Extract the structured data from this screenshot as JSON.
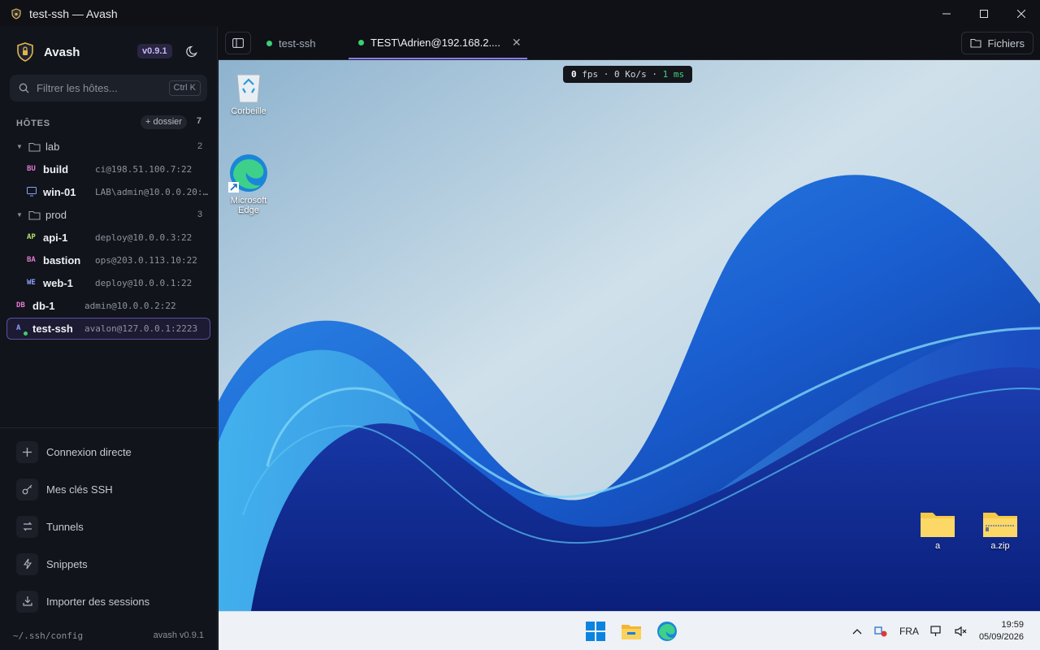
{
  "window": {
    "title": "test-ssh — Avash",
    "controls": [
      "minimize-icon",
      "maximize-icon",
      "close-icon"
    ]
  },
  "sidebar": {
    "app_name": "Avash",
    "version_badge": "v0.9.1",
    "search": {
      "placeholder": "Filtrer les hôtes...",
      "shortcut": "Ctrl K"
    },
    "hosts_title": "HÔTES",
    "add_folder_label": "+ dossier",
    "hosts_count": "7",
    "folders": [
      {
        "name": "lab",
        "count": "2",
        "hosts": [
          {
            "abbr": "BU",
            "name": "build",
            "address": "ci@198.51.100.7:22",
            "abbr_color": "#e07ad0"
          },
          {
            "abbr": "",
            "icon": "monitor-icon",
            "name": "win-01",
            "address": "LAB\\admin@10.0.0.20:…"
          }
        ]
      },
      {
        "name": "prod",
        "count": "3",
        "hosts": [
          {
            "abbr": "AP",
            "name": "api-1",
            "address": "deploy@10.0.0.3:22",
            "abbr_color": "#b8e06a"
          },
          {
            "abbr": "BA",
            "name": "bastion",
            "address": "ops@203.0.113.10:22",
            "abbr_color": "#e07ad0"
          },
          {
            "abbr": "WE",
            "name": "web-1",
            "address": "deploy@10.0.0.1:22",
            "abbr_color": "#8ea0ff"
          }
        ]
      }
    ],
    "root_hosts": [
      {
        "abbr": "DB",
        "name": "db-1",
        "address": "admin@10.0.0.2:22",
        "abbr_color": "#e07ad0"
      },
      {
        "abbr": "A",
        "name": "test-ssh",
        "address": "avalon@127.0.0.1:2223",
        "abbr_color": "#8ea0ff",
        "active": true,
        "online": true
      }
    ],
    "actions": [
      {
        "label": "Connexion directe",
        "icon": "plus-icon"
      },
      {
        "label": "Mes clés SSH",
        "icon": "key-icon"
      },
      {
        "label": "Tunnels",
        "icon": "tunnel-icon"
      },
      {
        "label": "Snippets",
        "icon": "lightning-icon"
      },
      {
        "label": "Importer des sessions",
        "icon": "import-icon"
      }
    ],
    "footer_left": "~/.ssh/config",
    "footer_right": "avash v0.9.1"
  },
  "tabs": [
    {
      "label": "test-ssh",
      "status": "connected",
      "active": false
    },
    {
      "label": "TEST\\Adrien@192.168.2....",
      "status": "connected",
      "active": true
    }
  ],
  "files_button": "Fichiers",
  "stats": {
    "fps": "0",
    "fps_unit": "fps",
    "throughput": "0 Ko/s",
    "latency": "1 ms"
  },
  "desktop": {
    "icons": [
      {
        "label": "Corbeille",
        "icon": "recycle-bin-icon"
      },
      {
        "label": "Microsoft Edge",
        "icon": "edge-icon"
      },
      {
        "label": "a",
        "icon": "folder-icon"
      },
      {
        "label": "a.zip",
        "icon": "zip-folder-icon"
      }
    ],
    "taskbar": {
      "apps": [
        "windows-start-icon",
        "file-explorer-icon",
        "edge-icon"
      ],
      "language": "FRA",
      "time": "19:59",
      "date": "05/09/2026"
    }
  },
  "colors": {
    "accent": "#8b78ee",
    "online": "#3ecf72",
    "sidebar_bg": "#11141b"
  }
}
